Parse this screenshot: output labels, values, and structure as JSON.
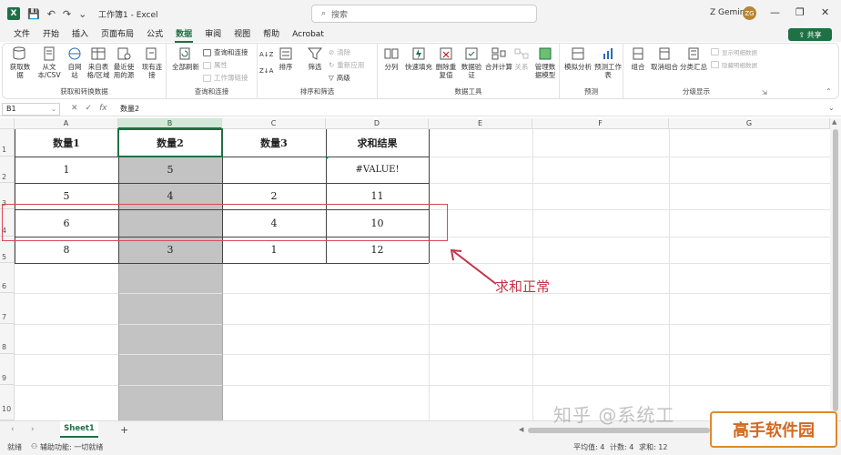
{
  "titlebar": {
    "app_logo": "X",
    "title": "工作簿1 - Excel",
    "search_placeholder": "搜索",
    "user": "Z Gemini",
    "avatar_initials": "ZG",
    "minimize": "—",
    "restore": "❐",
    "close": "✕"
  },
  "menu": {
    "tabs": [
      "文件",
      "开始",
      "插入",
      "页面布局",
      "公式",
      "数据",
      "审阅",
      "视图",
      "帮助",
      "Acrobat"
    ],
    "active": "数据",
    "share": "共享"
  },
  "ribbon": {
    "g1": {
      "label": "获取和转换数据",
      "buttons": [
        "获取数据",
        "从文本/CSV",
        "自网站",
        "来自表格/区域",
        "最近使用的源",
        "现有连接"
      ]
    },
    "g2": {
      "label": "查询和连接",
      "refresh": "全部刷新",
      "small": [
        "查询和连接",
        "属性",
        "工作簿链接"
      ]
    },
    "g3": {
      "label": "排序和筛选",
      "sort": "排序",
      "filter": "筛选",
      "small": [
        "清除",
        "重新应用",
        "高级"
      ]
    },
    "g4": {
      "label": "数据工具",
      "buttons": [
        "分列",
        "快速填充",
        "删除重复值",
        "数据验证",
        "合并计算",
        "关系",
        "管理数据模型"
      ]
    },
    "g5": {
      "label": "预测",
      "buttons": [
        "模拟分析",
        "预测工作表"
      ]
    },
    "g6": {
      "label": "分级显示",
      "buttons": [
        "组合",
        "取消组合",
        "分类汇总"
      ],
      "small": [
        "显示明细数据",
        "隐藏明细数据"
      ]
    }
  },
  "formula_bar": {
    "name_box": "B1",
    "content": "数量2"
  },
  "columns": [
    "A",
    "B",
    "C",
    "D",
    "E",
    "F",
    "G"
  ],
  "rows": [
    "1",
    "2",
    "3",
    "4",
    "5",
    "6",
    "7",
    "8",
    "9",
    "10"
  ],
  "table": {
    "headers": [
      "数量1",
      "数量2",
      "数量3",
      "求和结果"
    ],
    "rows": [
      [
        "1",
        "5",
        "",
        "#VALUE!"
      ],
      [
        "5",
        "4",
        "2",
        "11"
      ],
      [
        "6",
        "",
        "4",
        "10"
      ],
      [
        "8",
        "3",
        "1",
        "12"
      ]
    ]
  },
  "annotation": "求和正常",
  "sheets": {
    "tabs": [
      "Sheet1"
    ],
    "add": "+"
  },
  "status": {
    "ready": "就绪",
    "accessibility": "辅助功能: 一切就绪",
    "average": "平均值: 4",
    "count": "计数: 4",
    "sum": "求和: 12"
  },
  "watermark": {
    "text": "知乎 @系统工",
    "logo": "高手软件园"
  },
  "colors": {
    "brand": "#1e7145",
    "highlight": "#d9485a",
    "shade": "#c3c3c3"
  }
}
